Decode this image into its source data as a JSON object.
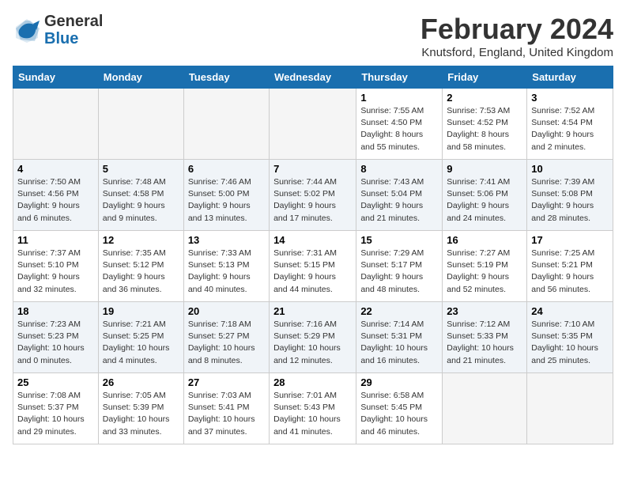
{
  "header": {
    "logo_general": "General",
    "logo_blue": "Blue",
    "title": "February 2024",
    "location": "Knutsford, England, United Kingdom"
  },
  "weekdays": [
    "Sunday",
    "Monday",
    "Tuesday",
    "Wednesday",
    "Thursday",
    "Friday",
    "Saturday"
  ],
  "weeks": [
    [
      {
        "day": "",
        "info": ""
      },
      {
        "day": "",
        "info": ""
      },
      {
        "day": "",
        "info": ""
      },
      {
        "day": "",
        "info": ""
      },
      {
        "day": "1",
        "info": "Sunrise: 7:55 AM\nSunset: 4:50 PM\nDaylight: 8 hours\nand 55 minutes."
      },
      {
        "day": "2",
        "info": "Sunrise: 7:53 AM\nSunset: 4:52 PM\nDaylight: 8 hours\nand 58 minutes."
      },
      {
        "day": "3",
        "info": "Sunrise: 7:52 AM\nSunset: 4:54 PM\nDaylight: 9 hours\nand 2 minutes."
      }
    ],
    [
      {
        "day": "4",
        "info": "Sunrise: 7:50 AM\nSunset: 4:56 PM\nDaylight: 9 hours\nand 6 minutes."
      },
      {
        "day": "5",
        "info": "Sunrise: 7:48 AM\nSunset: 4:58 PM\nDaylight: 9 hours\nand 9 minutes."
      },
      {
        "day": "6",
        "info": "Sunrise: 7:46 AM\nSunset: 5:00 PM\nDaylight: 9 hours\nand 13 minutes."
      },
      {
        "day": "7",
        "info": "Sunrise: 7:44 AM\nSunset: 5:02 PM\nDaylight: 9 hours\nand 17 minutes."
      },
      {
        "day": "8",
        "info": "Sunrise: 7:43 AM\nSunset: 5:04 PM\nDaylight: 9 hours\nand 21 minutes."
      },
      {
        "day": "9",
        "info": "Sunrise: 7:41 AM\nSunset: 5:06 PM\nDaylight: 9 hours\nand 24 minutes."
      },
      {
        "day": "10",
        "info": "Sunrise: 7:39 AM\nSunset: 5:08 PM\nDaylight: 9 hours\nand 28 minutes."
      }
    ],
    [
      {
        "day": "11",
        "info": "Sunrise: 7:37 AM\nSunset: 5:10 PM\nDaylight: 9 hours\nand 32 minutes."
      },
      {
        "day": "12",
        "info": "Sunrise: 7:35 AM\nSunset: 5:12 PM\nDaylight: 9 hours\nand 36 minutes."
      },
      {
        "day": "13",
        "info": "Sunrise: 7:33 AM\nSunset: 5:13 PM\nDaylight: 9 hours\nand 40 minutes."
      },
      {
        "day": "14",
        "info": "Sunrise: 7:31 AM\nSunset: 5:15 PM\nDaylight: 9 hours\nand 44 minutes."
      },
      {
        "day": "15",
        "info": "Sunrise: 7:29 AM\nSunset: 5:17 PM\nDaylight: 9 hours\nand 48 minutes."
      },
      {
        "day": "16",
        "info": "Sunrise: 7:27 AM\nSunset: 5:19 PM\nDaylight: 9 hours\nand 52 minutes."
      },
      {
        "day": "17",
        "info": "Sunrise: 7:25 AM\nSunset: 5:21 PM\nDaylight: 9 hours\nand 56 minutes."
      }
    ],
    [
      {
        "day": "18",
        "info": "Sunrise: 7:23 AM\nSunset: 5:23 PM\nDaylight: 10 hours\nand 0 minutes."
      },
      {
        "day": "19",
        "info": "Sunrise: 7:21 AM\nSunset: 5:25 PM\nDaylight: 10 hours\nand 4 minutes."
      },
      {
        "day": "20",
        "info": "Sunrise: 7:18 AM\nSunset: 5:27 PM\nDaylight: 10 hours\nand 8 minutes."
      },
      {
        "day": "21",
        "info": "Sunrise: 7:16 AM\nSunset: 5:29 PM\nDaylight: 10 hours\nand 12 minutes."
      },
      {
        "day": "22",
        "info": "Sunrise: 7:14 AM\nSunset: 5:31 PM\nDaylight: 10 hours\nand 16 minutes."
      },
      {
        "day": "23",
        "info": "Sunrise: 7:12 AM\nSunset: 5:33 PM\nDaylight: 10 hours\nand 21 minutes."
      },
      {
        "day": "24",
        "info": "Sunrise: 7:10 AM\nSunset: 5:35 PM\nDaylight: 10 hours\nand 25 minutes."
      }
    ],
    [
      {
        "day": "25",
        "info": "Sunrise: 7:08 AM\nSunset: 5:37 PM\nDaylight: 10 hours\nand 29 minutes."
      },
      {
        "day": "26",
        "info": "Sunrise: 7:05 AM\nSunset: 5:39 PM\nDaylight: 10 hours\nand 33 minutes."
      },
      {
        "day": "27",
        "info": "Sunrise: 7:03 AM\nSunset: 5:41 PM\nDaylight: 10 hours\nand 37 minutes."
      },
      {
        "day": "28",
        "info": "Sunrise: 7:01 AM\nSunset: 5:43 PM\nDaylight: 10 hours\nand 41 minutes."
      },
      {
        "day": "29",
        "info": "Sunrise: 6:58 AM\nSunset: 5:45 PM\nDaylight: 10 hours\nand 46 minutes."
      },
      {
        "day": "",
        "info": ""
      },
      {
        "day": "",
        "info": ""
      }
    ]
  ]
}
